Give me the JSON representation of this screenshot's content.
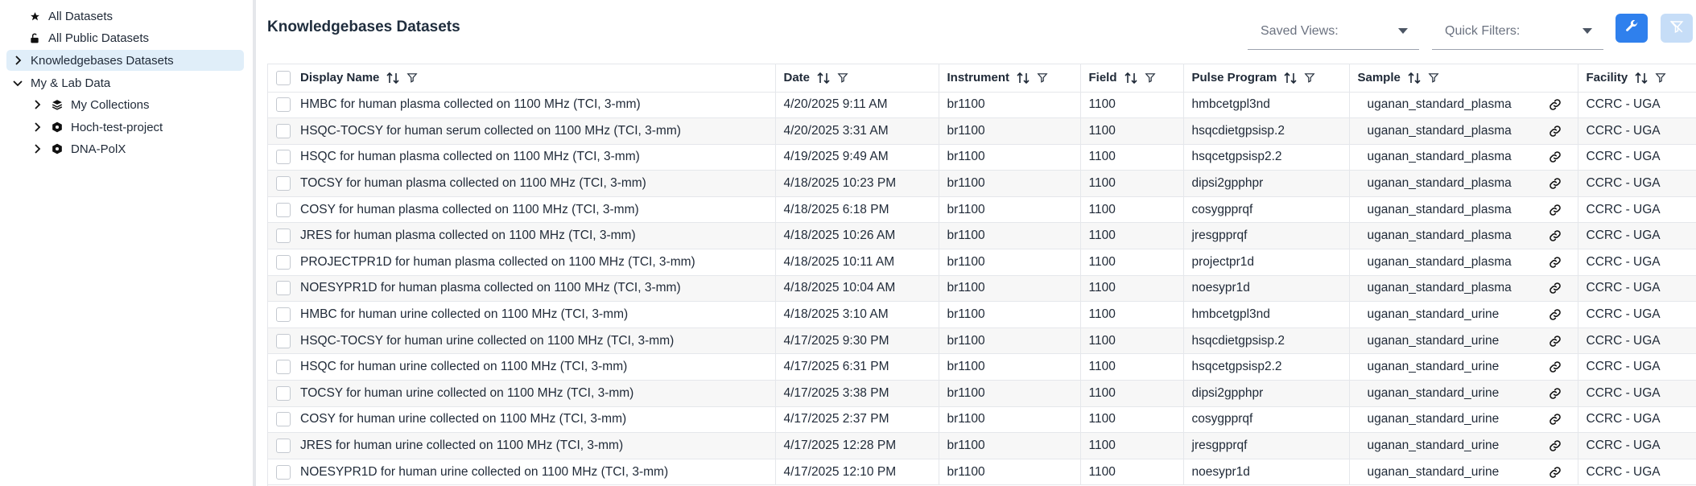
{
  "sidebar": {
    "items": [
      {
        "label": "All Datasets",
        "icon": "star-icon"
      },
      {
        "label": "All Public Datasets",
        "icon": "unlock-icon"
      },
      {
        "label": "Knowledgebases Datasets",
        "icon": "chevron-right-icon"
      },
      {
        "label": "My & Lab Data",
        "icon": "chevron-down-icon"
      },
      {
        "label": "My Collections",
        "icon": "collection-icon"
      },
      {
        "label": "Hoch-test-project",
        "icon": "project-icon"
      },
      {
        "label": "DNA-PolX",
        "icon": "project-icon"
      }
    ]
  },
  "header": {
    "title": "Knowledgebases Datasets",
    "saved_views_label": "Saved Views:",
    "quick_filters_label": "Quick Filters:",
    "colors": {
      "primary": "#2f80ed",
      "disabled": "#c6ddf7",
      "selected_bg": "#e0eef9"
    }
  },
  "table": {
    "columns": [
      "Display Name",
      "Date",
      "Instrument",
      "Field",
      "Pulse Program",
      "Sample",
      "Facility"
    ],
    "rows": [
      [
        "HMBC for human plasma collected on 1100 MHz (TCI, 3-mm)",
        "4/20/2025 9:11 AM",
        "br1100",
        "1100",
        "hmbcetgpl3nd",
        "uganan_standard_plasma",
        "CCRC - UGA"
      ],
      [
        "HSQC-TOCSY for human serum collected on 1100 MHz (TCI, 3-mm)",
        "4/20/2025 3:31 AM",
        "br1100",
        "1100",
        "hsqcdietgpsisp.2",
        "uganan_standard_plasma",
        "CCRC - UGA"
      ],
      [
        "HSQC for human plasma collected on 1100 MHz (TCI, 3-mm)",
        "4/19/2025 9:49 AM",
        "br1100",
        "1100",
        "hsqcetgpsisp2.2",
        "uganan_standard_plasma",
        "CCRC - UGA"
      ],
      [
        "TOCSY for human plasma collected on 1100 MHz (TCI, 3-mm)",
        "4/18/2025 10:23 PM",
        "br1100",
        "1100",
        "dipsi2gpphpr",
        "uganan_standard_plasma",
        "CCRC - UGA"
      ],
      [
        "COSY for human plasma collected on 1100 MHz (TCI, 3-mm)",
        "4/18/2025 6:18 PM",
        "br1100",
        "1100",
        "cosygpprqf",
        "uganan_standard_plasma",
        "CCRC - UGA"
      ],
      [
        "JRES for human plasma collected on 1100 MHz (TCI, 3-mm)",
        "4/18/2025 10:26 AM",
        "br1100",
        "1100",
        "jresgpprqf",
        "uganan_standard_plasma",
        "CCRC - UGA"
      ],
      [
        "PROJECTPR1D for human plasma collected on 1100 MHz (TCI, 3-mm)",
        "4/18/2025 10:11 AM",
        "br1100",
        "1100",
        "projectpr1d",
        "uganan_standard_plasma",
        "CCRC - UGA"
      ],
      [
        "NOESYPR1D for human plasma collected on 1100 MHz (TCI, 3-mm)",
        "4/18/2025 10:04 AM",
        "br1100",
        "1100",
        "noesypr1d",
        "uganan_standard_plasma",
        "CCRC - UGA"
      ],
      [
        "HMBC for human urine collected on 1100 MHz (TCI, 3-mm)",
        "4/18/2025 3:10 AM",
        "br1100",
        "1100",
        "hmbcetgpl3nd",
        "uganan_standard_urine",
        "CCRC - UGA"
      ],
      [
        "HSQC-TOCSY for human urine collected on 1100 MHz (TCI, 3-mm)",
        "4/17/2025 9:30 PM",
        "br1100",
        "1100",
        "hsqcdietgpsisp.2",
        "uganan_standard_urine",
        "CCRC - UGA"
      ],
      [
        "HSQC for human urine collected on 1100 MHz (TCI, 3-mm)",
        "4/17/2025 6:31 PM",
        "br1100",
        "1100",
        "hsqcetgpsisp2.2",
        "uganan_standard_urine",
        "CCRC - UGA"
      ],
      [
        "TOCSY for human urine collected on 1100 MHz (TCI, 3-mm)",
        "4/17/2025 3:38 PM",
        "br1100",
        "1100",
        "dipsi2gpphpr",
        "uganan_standard_urine",
        "CCRC - UGA"
      ],
      [
        "COSY for human urine collected on 1100 MHz (TCI, 3-mm)",
        "4/17/2025 2:37 PM",
        "br1100",
        "1100",
        "cosygpprqf",
        "uganan_standard_urine",
        "CCRC - UGA"
      ],
      [
        "JRES for human urine collected on 1100 MHz (TCI, 3-mm)",
        "4/17/2025 12:28 PM",
        "br1100",
        "1100",
        "jresgpprqf",
        "uganan_standard_urine",
        "CCRC - UGA"
      ],
      [
        "NOESYPR1D for human urine collected on 1100 MHz (TCI, 3-mm)",
        "4/17/2025 12:10 PM",
        "br1100",
        "1100",
        "noesypr1d",
        "uganan_standard_urine",
        "CCRC - UGA"
      ]
    ]
  }
}
